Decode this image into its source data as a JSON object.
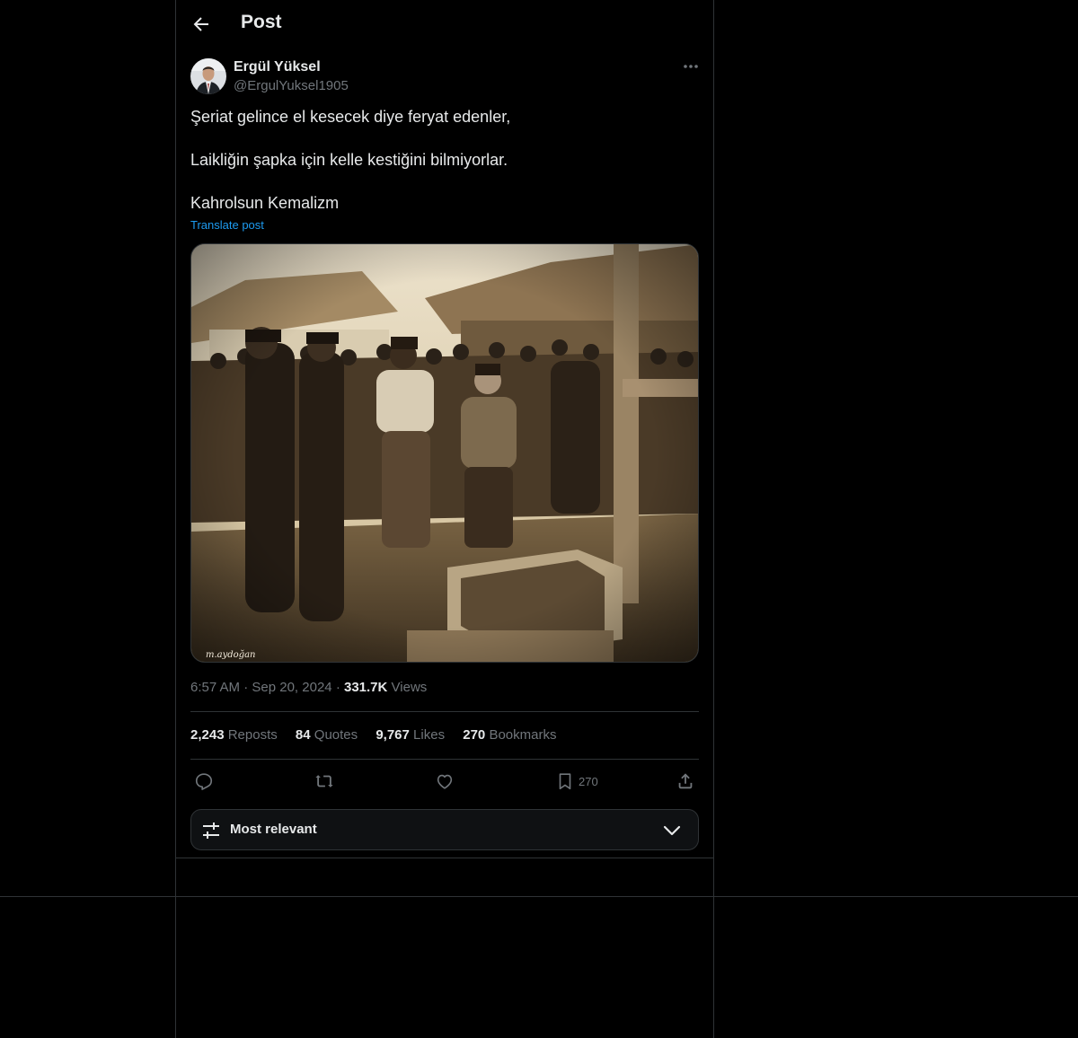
{
  "header": {
    "title": "Post"
  },
  "author": {
    "name": "Ergül Yüksel",
    "handle": "@ErgulYuksel1905"
  },
  "post": {
    "lines": [
      "Şeriat gelince el kesecek diye feryat edenler,",
      "Laikliğin şapka için kelle kestiğini bilmiyorlar.",
      "Kahrolsun Kemalizm"
    ],
    "translate_label": "Translate post",
    "image_watermark": "m.aydoğan"
  },
  "meta": {
    "time": "6:57 AM",
    "date": "Sep 20, 2024",
    "views_count": "331.7K",
    "views_label": "Views"
  },
  "stats": [
    {
      "count": "2,243",
      "label": "Reposts"
    },
    {
      "count": "84",
      "label": "Quotes"
    },
    {
      "count": "9,767",
      "label": "Likes"
    },
    {
      "count": "270",
      "label": "Bookmarks"
    }
  ],
  "actions": {
    "reply_icon": "reply-icon",
    "repost_icon": "repost-icon",
    "like_icon": "heart-icon",
    "bookmark_icon": "bookmark-icon",
    "bookmark_count": "270",
    "share_icon": "share-icon"
  },
  "sort": {
    "label": "Most relevant"
  },
  "colors": {
    "accent": "#1d9bf0",
    "text": "#e7e9ea",
    "muted": "#71767b",
    "border": "#2f3336",
    "background": "#000000"
  }
}
